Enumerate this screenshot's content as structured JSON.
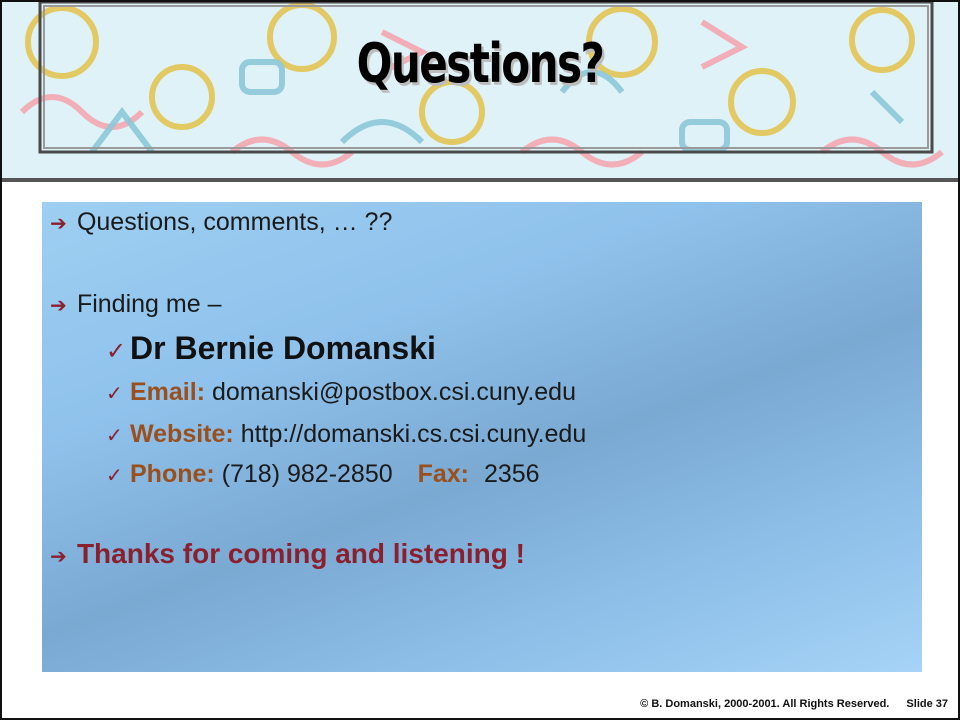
{
  "slide": {
    "title": "Questions?",
    "bullets": [
      {
        "text": "Questions, comments, … ??"
      },
      {
        "text": "Finding me –"
      }
    ],
    "contact": {
      "name": "Dr Bernie Domanski",
      "email_label": "Email:",
      "email_value": "domanski@postbox.csi.cuny.edu",
      "website_label": "Website:",
      "website_value": "http://domanski.cs.csi.cuny.edu",
      "phone_label": "Phone:",
      "phone_value": "(718) 982-2850",
      "fax_label": "Fax:",
      "fax_value": "2356"
    },
    "closing": "Thanks for coming and listening !",
    "footer": {
      "copyright": "© B. Domanski, 2000-2001.  All Rights Reserved.",
      "slide_number": "Slide 37"
    }
  },
  "icons": {
    "bullet": "arrow-right-icon",
    "sub_bullet": "checkmark-icon",
    "banner_art": "lightbulb-pattern"
  },
  "colors": {
    "accent": "#8a1f2e",
    "label": "#9a4f1c",
    "panel": "#8fc2ec"
  }
}
